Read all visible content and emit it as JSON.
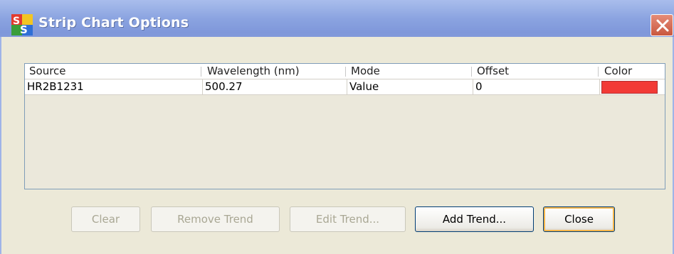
{
  "window": {
    "title": "Strip Chart Options",
    "icon": "ss-app-icon"
  },
  "grid": {
    "columns": [
      "Source",
      "Wavelength (nm)",
      "Mode",
      "Offset",
      "Color"
    ],
    "rows": [
      {
        "source": "HR2B1231",
        "wavelength": "500.27",
        "mode": "Value",
        "offset": "0",
        "color": "#f23a36"
      }
    ]
  },
  "buttons": {
    "clear": "Clear",
    "remove_trend": "Remove Trend",
    "edit_trend": "Edit Trend...",
    "add_trend": "Add Trend...",
    "close": "Close"
  },
  "colors": {
    "accent_title": "#8aa3e0",
    "default_button_ring": "#f4b54a"
  }
}
